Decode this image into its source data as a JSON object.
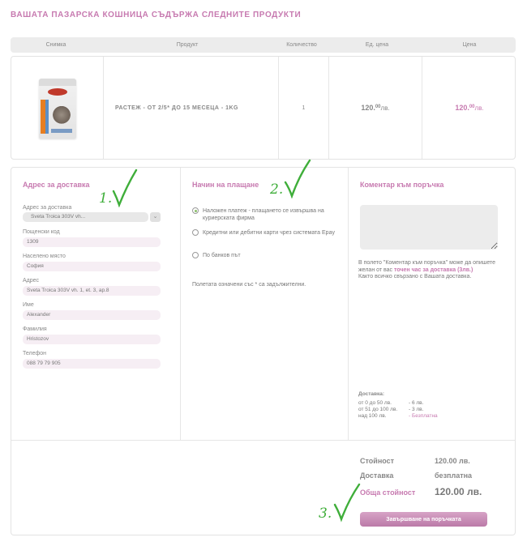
{
  "page_title": "ВАШАТА ПАЗАРСКА КОШНИЦА СЪДЪРЖА СЛЕДНИТЕ ПРОДУКТИ",
  "cart_header": {
    "image": "Снимка",
    "product": "Продукт",
    "quantity": "Количество",
    "unit_price": "Ед. цена",
    "price": "Цена"
  },
  "product": {
    "image_icon": "cat-food-bag",
    "name": "РАСТЕЖ - ОТ 2/5* ДО 15 МЕСЕЦА - 1KG",
    "quantity": "1",
    "unit_price_int": "120.",
    "unit_price_dec": "00",
    "unit_price_cur": "лв.",
    "total_int": "120.",
    "total_dec": "00",
    "total_cur": "лв."
  },
  "delivery_address": {
    "title": "Адрес за доставка",
    "address_select_label": "Адрес за доставка",
    "address_select_value": "Sveta Troica 303V vh...",
    "address_select_icon": "chevron-down-icon",
    "postal_code_label": "Пощенски код",
    "postal_code_value": "1309",
    "city_label": "Населено място",
    "city_value": "София",
    "address_label": "Адрес",
    "address_value": "Sveta Troica 303V vh. 1, et. 3, ap.8",
    "first_name_label": "Име",
    "first_name_value": "Alexander",
    "last_name_label": "Фамилия",
    "last_name_value": "Hristozov",
    "phone_label": "Телефон",
    "phone_value": "088 79 79 905"
  },
  "payment": {
    "title": "Начин на плащане",
    "options": [
      "Наложен платеж - плащането се извършва на куриерската фирма",
      "Кредитни или дебитни карти чрез системата Epay",
      "По банков път"
    ],
    "selected_index": 0,
    "required_note": "Полетата означени със * са задължителни."
  },
  "comment": {
    "title": "Коментар към поръчка",
    "help_1": "В полето \"Коментар към поръчка\" може да опишете желан от вас ",
    "help_bold": "точен час за доставка (3лв.)",
    "help_2": "Както всичко свързано с Вашата доставка."
  },
  "delivery_rates": {
    "title": "Доставка:",
    "rows": [
      {
        "range": "от 0 до 50 лв.",
        "value": "- 6 лв."
      },
      {
        "range": "от 51 до 100 лв.",
        "value": "- 3 лв."
      },
      {
        "range": "над 100 лв.",
        "value": "- Безплатна"
      }
    ]
  },
  "totals": {
    "subtotal_label": "Стойност",
    "subtotal_value": "120.00 лв.",
    "delivery_label": "Доставка",
    "delivery_value": "безплатна",
    "grand_label": "Обща стойност",
    "grand_value": "120.00 лв.",
    "finish_button": "Завършване на поръчката"
  },
  "annotations": {
    "mark_1": "1.",
    "mark_2": "2.",
    "mark_3": "3.",
    "color": "#3fae3a"
  },
  "colors": {
    "accent": "#c77ab0",
    "field_bg": "#f6eef4"
  }
}
